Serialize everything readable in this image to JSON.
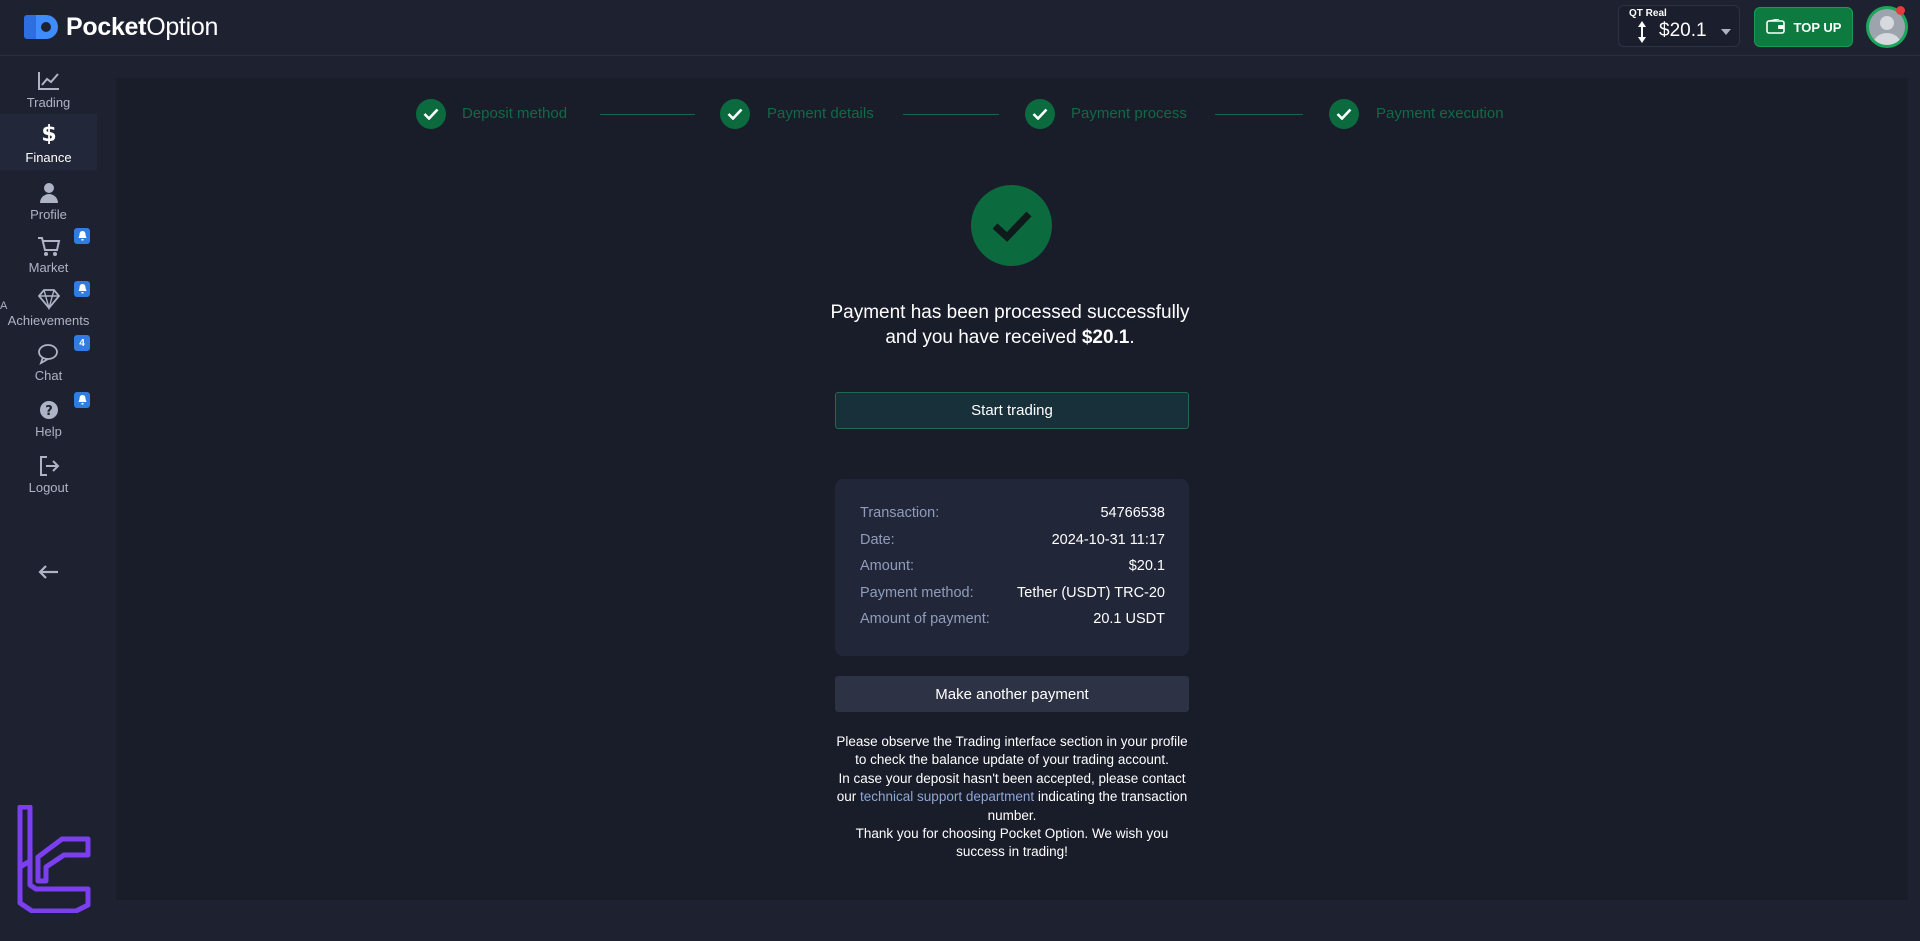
{
  "header": {
    "logo_bold": "Pocket",
    "logo_light": "Option",
    "account_label": "QT Real",
    "balance": "$20.1",
    "topup_label": "TOP UP"
  },
  "sidebar": {
    "items": [
      {
        "label": "Trading",
        "icon": "chart-line-icon"
      },
      {
        "label": "Finance",
        "icon": "dollar-icon"
      },
      {
        "label": "Profile",
        "icon": "user-icon"
      },
      {
        "label": "Market",
        "icon": "cart-icon",
        "badge": "bell"
      },
      {
        "label": "Achievements",
        "icon": "diamond-icon",
        "badge": "bell"
      },
      {
        "label": "Chat",
        "icon": "chat-icon",
        "badge": "4"
      },
      {
        "label": "Help",
        "icon": "help-icon",
        "badge": "bell"
      },
      {
        "label": "Logout",
        "icon": "logout-icon"
      }
    ],
    "edge_char": "A"
  },
  "steps": [
    {
      "label": "Deposit method"
    },
    {
      "label": "Payment details"
    },
    {
      "label": "Payment process"
    },
    {
      "label": "Payment execution"
    }
  ],
  "result": {
    "line1": "Payment has been processed successfully",
    "line2_prefix": "and you have received ",
    "amount": "$20.1",
    "line2_suffix": "."
  },
  "start_trading_label": "Start trading",
  "details": [
    {
      "key": "Transaction:",
      "value": "54766538"
    },
    {
      "key": "Date:",
      "value": "2024-10-31 11:17"
    },
    {
      "key": "Amount:",
      "value": "$20.1"
    },
    {
      "key": "Payment method:",
      "value": "Tether (USDT) TRC-20"
    },
    {
      "key": "Amount of payment:",
      "value": "20.1 USDT"
    }
  ],
  "make_another_label": "Make another payment",
  "notes": {
    "p1": "Please observe the Trading interface section in your profile to check the balance update of your trading account.",
    "p2_prefix": "In case your deposit hasn't been accepted, please contact our ",
    "p2_link": "technical support department",
    "p2_suffix": " indicating the transaction number.",
    "p3": "Thank you for choosing Pocket Option. We wish you success in trading!"
  },
  "colors": {
    "background": "#1e2130",
    "panel": "#191c29",
    "success_green": "#0c6b3e",
    "topup_green": "#0d7a3f",
    "step_text": "#116a45",
    "link": "#8fa7d6",
    "badge_blue": "#2f7de1",
    "watermark_purple": "#7b3ff0"
  }
}
